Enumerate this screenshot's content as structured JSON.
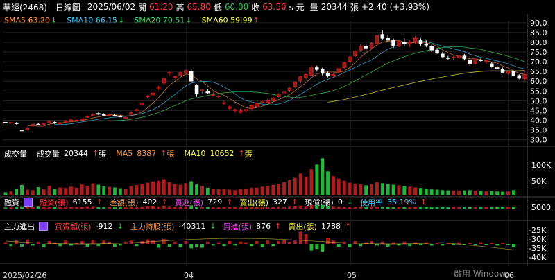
{
  "header": {
    "stock": "華經(2468)",
    "chart_type": "日線圖",
    "date": "2025/06/02",
    "open_label": "開",
    "open": "61.20",
    "high_label": "高",
    "high": "65.80",
    "low_label": "低",
    "low": "60.00",
    "close_label": "收",
    "close": "63.50",
    "unit": "s 元",
    "volume_label": "量",
    "volume": "20344",
    "volume_unit": "張",
    "change": "+2.40 (+3.93%)"
  },
  "ma_legend": [
    {
      "label": "SMA5 63.20",
      "arrow": "down",
      "color": "#ff9a40"
    },
    {
      "label": "SMA10 66.15",
      "arrow": "down",
      "color": "#44c8ff"
    },
    {
      "label": "SMA20 70.51",
      "arrow": "down",
      "color": "#40e060"
    },
    {
      "label": "SMA60 59.99",
      "arrow": "up",
      "color": "#ffff40"
    }
  ],
  "volume_legend": {
    "title": "成交量",
    "items": [
      {
        "label": "成交量",
        "value": "20344",
        "arrow": "up",
        "unit": "張"
      },
      {
        "label": "MA5",
        "value": "8387",
        "arrow": "up",
        "unit": "張"
      },
      {
        "label": "MA10",
        "value": "10652",
        "arrow": "up",
        "unit": "張"
      }
    ]
  },
  "margin_legend": {
    "title": "融資",
    "items": [
      {
        "label": "融資(張)",
        "value": "6155",
        "arrow": "up"
      },
      {
        "label": "差額(張)",
        "value": "402",
        "arrow": "up"
      },
      {
        "label": "買進(張)",
        "value": "729",
        "arrow": "up"
      },
      {
        "label": "賣出(張)",
        "value": "327",
        "arrow": "up"
      },
      {
        "label": "現償(張)",
        "value": "0",
        "arrow": "down"
      },
      {
        "label": "使用率",
        "value": "35.19%",
        "arrow": "up"
      }
    ]
  },
  "main_legend": {
    "title": "主力進出",
    "items": [
      {
        "label": "買賣超(張)",
        "value": "-912",
        "arrow": "down"
      },
      {
        "label": "主力持股(張)",
        "value": "-40311",
        "arrow": "down"
      },
      {
        "label": "買進(張)",
        "value": "876",
        "arrow": "up"
      },
      {
        "label": "賣出(張)",
        "value": "1788",
        "arrow": "up"
      }
    ]
  },
  "axes": {
    "price_ticks": [
      "90.0",
      "85.0",
      "80.0",
      "75.0",
      "70.0",
      "65.0",
      "60.0",
      "55.0",
      "50.0",
      "45.0",
      "40.0",
      "35.0",
      "30.0"
    ],
    "volume_ticks": [
      "100K",
      "50K"
    ],
    "margin_ticks": [
      "5000"
    ],
    "main_ticks": [
      "-25K",
      "-30K",
      "-35K",
      "-40K"
    ],
    "x_labels": [
      "2025/02/26",
      "04",
      "05",
      "06"
    ]
  },
  "watermark": "啟用 Windows",
  "colors": {
    "up": "#ff3b3b",
    "down": "#22d14a",
    "grid": "#333"
  },
  "chart_data": {
    "type": "candlestick",
    "ylim": [
      27,
      91
    ],
    "candles": [
      [
        39,
        39,
        38.5,
        38.5
      ],
      [
        38.5,
        39,
        38.2,
        38.8
      ],
      [
        38.5,
        39,
        37.8,
        38.2
      ],
      [
        35,
        35.8,
        33.8,
        34.5
      ],
      [
        35,
        36.5,
        34.8,
        36.2
      ],
      [
        37,
        38.2,
        37,
        38
      ],
      [
        38,
        38.4,
        37.6,
        37.8
      ],
      [
        38,
        38.4,
        37.6,
        38.2
      ],
      [
        38.5,
        40,
        38.5,
        39.5
      ],
      [
        39,
        39.5,
        38,
        38.5
      ],
      [
        38,
        39,
        38,
        38.8
      ],
      [
        39,
        40,
        38.8,
        39.5
      ],
      [
        39.5,
        40.5,
        39.2,
        40.2
      ],
      [
        40,
        40.5,
        39.5,
        40
      ],
      [
        40,
        41,
        40,
        40.8
      ],
      [
        41.5,
        42.5,
        41.3,
        41.8
      ],
      [
        42,
        43.5,
        42,
        43
      ],
      [
        43.5,
        44,
        42.8,
        43
      ],
      [
        43,
        43.5,
        42.2,
        42.5
      ],
      [
        42.5,
        43,
        42,
        42.8
      ],
      [
        42.5,
        43,
        42,
        42.2
      ],
      [
        42,
        42.5,
        41.5,
        41.8
      ],
      [
        41,
        41.8,
        40.5,
        41.5
      ],
      [
        43,
        44.5,
        42.8,
        44
      ],
      [
        45,
        46,
        44.5,
        45.5
      ],
      [
        48,
        49,
        47.5,
        48.5
      ],
      [
        52,
        53,
        51.5,
        52.5
      ],
      [
        53,
        54.5,
        52.5,
        54
      ],
      [
        56,
        57.5,
        55.5,
        57
      ],
      [
        59,
        62,
        58.5,
        61.5
      ],
      [
        64,
        65,
        63,
        64.5
      ],
      [
        62,
        63,
        61,
        62.5
      ],
      [
        63,
        65,
        62.5,
        64.5
      ],
      [
        64,
        66,
        63.5,
        65.5
      ],
      [
        65,
        66,
        59,
        60
      ],
      [
        58,
        58.5,
        52,
        53.5
      ],
      [
        55,
        56,
        53.5,
        55.5
      ],
      [
        55,
        56,
        53.5,
        54
      ],
      [
        53,
        54.5,
        52,
        53
      ],
      [
        52,
        53,
        51,
        52.5
      ],
      [
        49,
        50,
        48,
        49
      ],
      [
        46,
        47.5,
        45.5,
        47
      ],
      [
        45,
        46,
        44,
        45.5
      ],
      [
        44,
        46,
        43.5,
        45
      ],
      [
        45,
        46,
        44,
        45.5
      ],
      [
        46,
        48,
        45.5,
        47.5
      ],
      [
        47,
        49,
        46.5,
        48.5
      ],
      [
        49,
        50,
        48.5,
        49.5
      ],
      [
        49,
        51,
        48.5,
        50
      ],
      [
        50,
        52,
        49.5,
        51.5
      ],
      [
        52,
        54,
        51.5,
        53.5
      ],
      [
        54,
        55,
        53.5,
        54.5
      ],
      [
        55,
        57,
        54.5,
        56.5
      ],
      [
        57,
        60,
        56.5,
        59.5
      ],
      [
        60,
        63,
        58.5,
        62.5
      ],
      [
        62,
        64,
        61,
        63.5
      ],
      [
        63,
        68,
        62.5,
        67
      ],
      [
        67,
        68,
        65,
        66
      ],
      [
        66,
        67,
        63,
        64
      ],
      [
        64,
        65,
        62,
        63
      ],
      [
        63,
        64,
        62,
        63.5
      ],
      [
        65,
        67,
        64,
        66.5
      ],
      [
        67,
        70,
        66.5,
        69.5
      ],
      [
        70,
        73,
        69.5,
        72.5
      ],
      [
        73,
        76,
        72.5,
        75.5
      ],
      [
        76,
        79,
        75,
        78
      ],
      [
        78,
        79,
        75,
        77
      ],
      [
        77,
        80,
        76.5,
        79.5
      ],
      [
        79,
        84,
        78,
        83.5
      ],
      [
        84,
        86,
        81,
        82
      ],
      [
        82,
        84,
        80,
        81
      ],
      [
        81,
        82,
        77,
        78
      ],
      [
        78,
        81,
        77.5,
        80.5
      ],
      [
        80,
        82,
        78,
        79
      ],
      [
        79,
        81,
        77.5,
        80
      ],
      [
        80,
        83,
        79,
        82
      ],
      [
        81,
        82,
        78,
        79
      ],
      [
        79,
        81,
        77.5,
        78.5
      ],
      [
        78,
        79,
        75,
        76
      ],
      [
        76,
        77,
        74,
        74.5
      ],
      [
        74,
        75,
        72,
        72.5
      ],
      [
        72,
        73,
        71,
        71.8
      ],
      [
        72,
        73,
        71,
        72.5
      ],
      [
        72,
        73.5,
        71.5,
        73
      ],
      [
        73,
        74,
        71,
        71.5
      ],
      [
        71,
        72.5,
        68,
        69
      ],
      [
        69,
        72,
        68.5,
        71.5
      ],
      [
        71,
        72,
        70,
        70.5
      ],
      [
        70,
        71,
        69,
        70.5
      ],
      [
        69,
        70,
        67,
        67.5
      ],
      [
        67,
        68,
        66,
        66.5
      ],
      [
        66,
        67,
        64,
        64.5
      ],
      [
        64,
        65.5,
        63.5,
        65
      ],
      [
        65,
        65.5,
        62.5,
        63
      ],
      [
        63,
        63.5,
        61,
        61.5
      ],
      [
        61.2,
        65.8,
        60,
        63.5
      ]
    ],
    "volume": [
      1.2,
      1.5,
      2.6,
      3.9,
      2.2,
      2.0,
      3.1,
      2.4,
      3.6,
      2.5,
      3.0,
      2.8,
      3.3,
      2.9,
      4.1,
      3.6,
      4.5,
      4.0,
      3.5,
      3.2,
      3.0,
      2.7,
      2.6,
      3.5,
      3.9,
      4.3,
      4.8,
      5.2,
      5.5,
      6.1,
      5.0,
      4.2,
      4.0,
      4.6,
      5.3,
      4.1,
      3.5,
      2.9,
      2.6,
      2.3,
      2.5,
      2.2,
      2.0,
      2.4,
      2.6,
      2.8,
      2.9,
      3.3,
      3.6,
      3.9,
      4.4,
      5.0,
      5.7,
      6.6,
      8.2,
      7.0,
      9.8,
      11.6,
      13.9,
      9.0,
      7.2,
      6.3,
      5.5,
      4.8,
      4.4,
      4.1,
      3.8,
      4.2,
      5.0,
      4.6,
      4.3,
      4.0,
      3.8,
      3.5,
      3.3,
      3.0,
      2.8,
      2.6,
      2.3,
      2.2,
      2.0,
      1.9,
      1.8,
      1.8,
      1.9,
      2.0,
      1.8,
      1.7,
      1.6,
      1.6,
      1.5,
      1.4,
      1.5,
      2.0
    ],
    "margin": [
      0.2,
      0.3,
      0.5,
      0.8,
      0.6,
      0.4,
      0.9,
      0.7,
      0.6,
      0.5,
      0.4,
      0.6,
      0.5,
      0.4,
      0.3,
      0.8,
      0.9,
      0.6,
      0.5,
      0.4,
      0.3,
      0.4,
      0.5,
      0.7,
      0.6,
      0.8,
      0.9,
      1.0,
      0.8,
      1.1,
      0.9,
      0.7,
      0.6,
      0.8,
      1.2,
      0.6,
      0.5,
      0.4,
      0.6,
      0.5,
      0.4,
      0.5,
      0.4,
      0.6,
      0.5,
      0.4,
      0.6,
      0.7,
      0.5,
      0.6,
      0.8,
      0.7,
      0.9,
      1.0,
      1.1,
      0.9,
      1.3,
      1.2,
      1.4,
      1.0,
      0.9,
      0.8,
      0.7,
      0.6,
      0.5,
      0.6,
      0.7,
      0.8,
      0.6,
      0.5,
      0.4,
      0.5,
      0.6,
      0.4,
      0.5,
      0.4,
      0.3,
      0.4,
      0.5,
      0.3,
      0.4,
      0.5,
      0.3,
      0.4,
      0.3,
      0.5,
      0.4,
      0.3,
      0.4,
      0.3,
      0.4,
      0.5,
      0.4,
      0.6
    ],
    "main": [
      0.3,
      -0.4,
      0.6,
      -0.5,
      0.8,
      -0.3,
      0.4,
      -0.6,
      0.5,
      0.3,
      -0.4,
      0.6,
      -0.3,
      0.2,
      0.5,
      -0.5,
      0.7,
      -0.4,
      0.6,
      0.4,
      -0.5,
      -0.3,
      0.4,
      0.6,
      -0.4,
      0.5,
      0.8,
      0.6,
      -0.7,
      0.9,
      -0.5,
      0.4,
      -0.6,
      0.5,
      -0.8,
      -0.6,
      -0.7,
      0.4,
      -0.3,
      0.3,
      -0.4,
      0.5,
      -0.3,
      0.4,
      0.3,
      -0.4,
      0.5,
      -0.6,
      0.6,
      -0.4,
      0.5,
      0.7,
      0.4,
      0.6,
      2.2,
      1.8,
      -1.2,
      -0.9,
      -1.4,
      1.0,
      0.6,
      -0.5,
      0.4,
      -0.6,
      0.5,
      -0.4,
      0.3,
      0.5,
      -0.3,
      0.4,
      -0.5,
      0.3,
      -0.3,
      0.4,
      -0.4,
      0.3,
      -0.2,
      0.3,
      -0.3,
      0.2,
      -0.3,
      0.2,
      -0.2,
      0.3,
      -0.2,
      0.2,
      -0.2,
      0.3,
      -0.2,
      0.2,
      -0.3,
      0.2,
      -0.2,
      -0.6
    ]
  }
}
